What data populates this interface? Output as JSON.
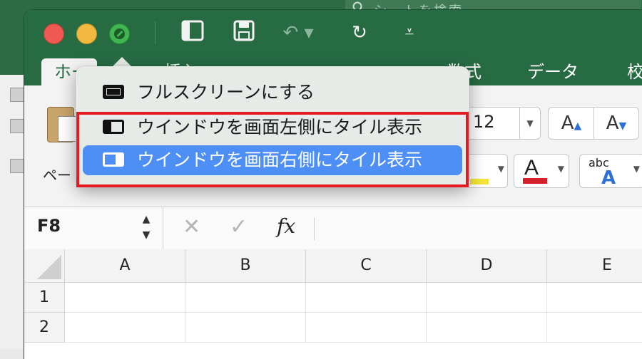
{
  "background": {
    "search_placeholder": "シートを検索"
  },
  "ribbon": {
    "tabs": [
      {
        "label": "ホーム"
      },
      {
        "label": "挿入"
      },
      {
        "label": "数式"
      },
      {
        "label": "データ"
      },
      {
        "label": "校"
      }
    ],
    "paste_label": "ペー",
    "font_size_value": "12",
    "grow_font_label": "A",
    "shrink_font_label": "A",
    "font_color_letter": "A",
    "spelling_abc": "abc",
    "spelling_letter": "A"
  },
  "formula_bar": {
    "name_box": "F8",
    "fx_label": "fx"
  },
  "grid": {
    "columns": [
      "A",
      "B",
      "C",
      "D",
      "E"
    ],
    "rows": [
      "1",
      "2"
    ]
  },
  "window_menu": {
    "items": [
      {
        "label": "フルスクリーンにする",
        "icon": "fullscreen-icon",
        "selected": false
      },
      {
        "label": "ウインドウを画面左側にタイル表示",
        "icon": "tile-left-icon",
        "selected": false
      },
      {
        "label": "ウインドウを画面右側にタイル表示",
        "icon": "tile-right-icon",
        "selected": true
      }
    ]
  },
  "colors": {
    "titlebar_green": "#276b43",
    "menu_selection_blue": "#4e8ff6",
    "annotation_red": "#e31b23",
    "font_color_red": "#d4202a"
  }
}
